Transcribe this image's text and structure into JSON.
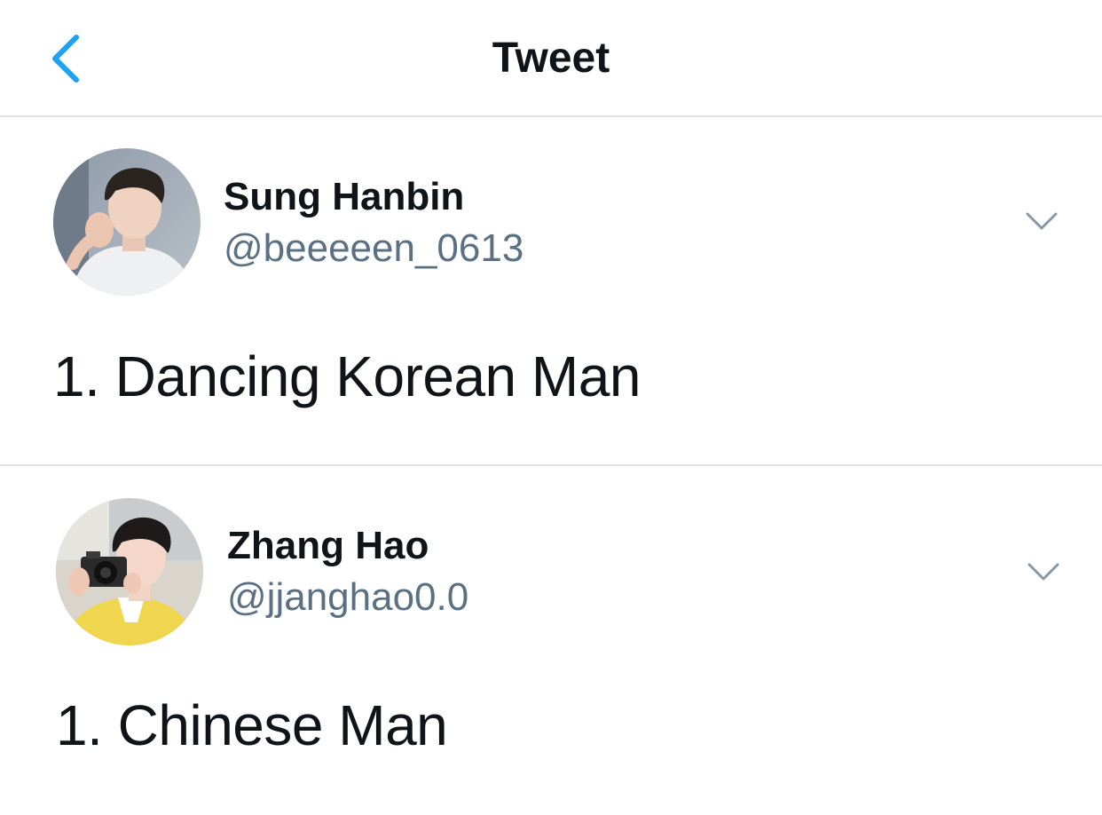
{
  "header": {
    "title": "Tweet",
    "back_icon": "chevron-left-icon",
    "accent_color": "#1da1f2"
  },
  "tweets": [
    {
      "display_name": "Sung Hanbin",
      "handle": "@beeeeen_0613",
      "text": "1. Dancing Korean Man",
      "avatar": "avatar-photo",
      "more_icon": "chevron-down-icon"
    },
    {
      "display_name": "Zhang Hao",
      "handle": "@jjanghao0.0",
      "text": "1. Chinese Man",
      "avatar": "avatar-photo",
      "more_icon": "chevron-down-icon"
    }
  ],
  "colors": {
    "text_primary": "#0f1419",
    "text_secondary": "#5b7083",
    "divider": "#dfe3e6",
    "icon_gray": "#8899a6"
  }
}
